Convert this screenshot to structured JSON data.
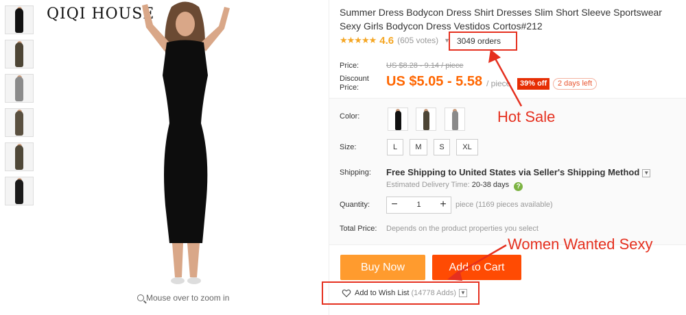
{
  "gallery": {
    "brand": "QIQI HOUSE",
    "zoom_hint": "Mouse over to zoom in",
    "thumbnails": [
      "black",
      "olive",
      "grey",
      "olive-2",
      "olive-3",
      "black-2"
    ]
  },
  "product": {
    "title": "Summer Dress Bodycon Dress Shirt Dresses Slim Short Sleeve Sportswear Sexy Girls Bodycon Dress Vestidos Cortos#212",
    "stars": "★★★★★",
    "rating": "4.6",
    "votes": "(605 votes)",
    "orders": "3049 orders"
  },
  "price": {
    "label": "Price:",
    "original": "US $8.28 - 9.14 / piece",
    "discount_label_1": "Discount",
    "discount_label_2": "Price:",
    "discounted": "US $5.05 - 5.58",
    "per": "/ piece",
    "off": "39% off",
    "days_left": "2 days left"
  },
  "options": {
    "color_label": "Color:",
    "colors": [
      {
        "name": "black",
        "hex": "#111111"
      },
      {
        "name": "olive",
        "hex": "#4d4535"
      },
      {
        "name": "grey",
        "hex": "#8a8a8a"
      }
    ],
    "size_label": "Size:",
    "sizes": [
      "L",
      "M",
      "S",
      "XL"
    ],
    "shipping_label": "Shipping:",
    "shipping_text": "Free Shipping to United States via Seller's Shipping Method",
    "est_label": "Estimated Delivery Time:",
    "est_days": "20-38 days",
    "quantity_label": "Quantity:",
    "quantity": "1",
    "quantity_avail": "piece (1169 pieces available)",
    "total_label": "Total Price:",
    "total_note": "Depends on the product properties you select"
  },
  "actions": {
    "buy_now": "Buy Now",
    "add_to_cart": "Add to Cart",
    "wish_list": "Add to Wish List",
    "wish_count": "(14778 Adds)"
  },
  "annotations": {
    "hot_sale": "Hot Sale",
    "women_wanted": "Women Wanted Sexy"
  },
  "colors": {
    "accent_orange": "#ff6600",
    "buy_now_bg": "#ff9b2e",
    "add_to_cart_bg": "#ff4b03",
    "annotation_red": "#e5301f",
    "star": "#f5a623"
  }
}
